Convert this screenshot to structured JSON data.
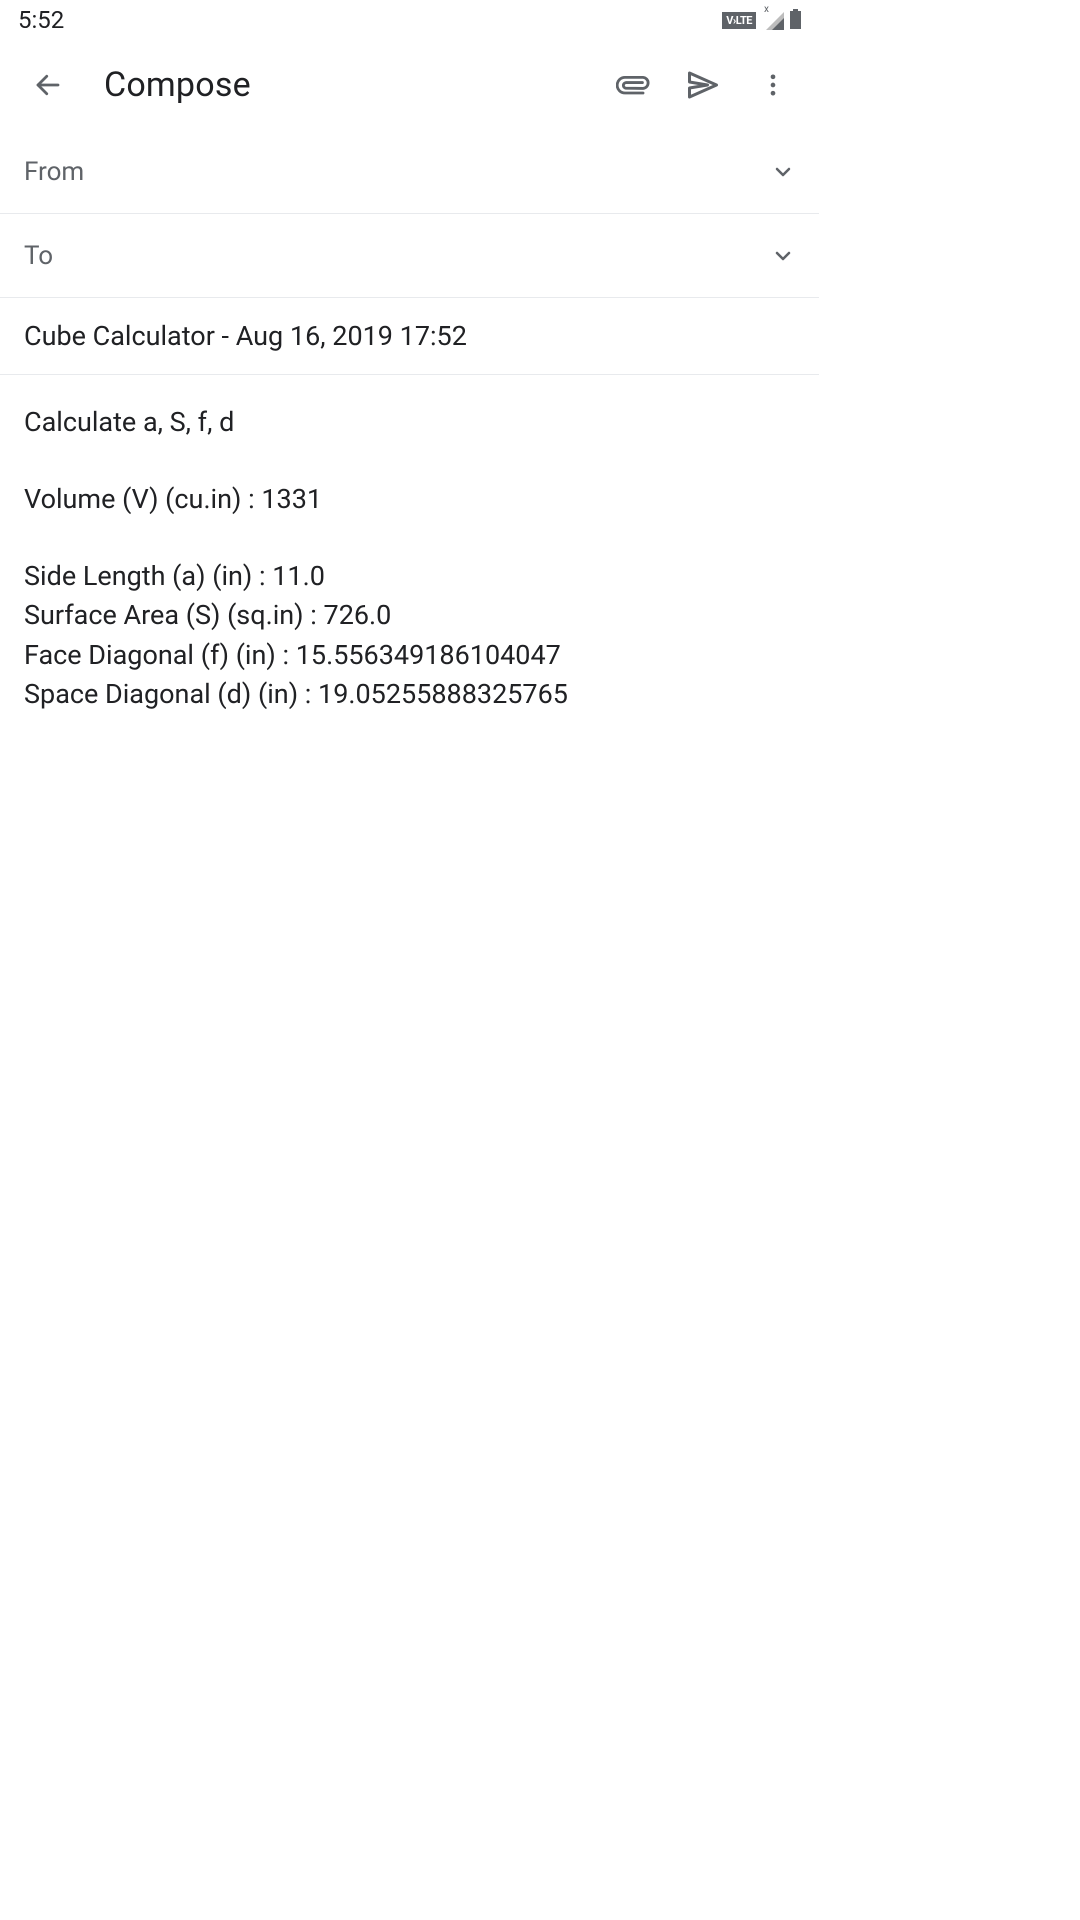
{
  "statusBar": {
    "time": "5:52",
    "volte": "V›LTE"
  },
  "toolbar": {
    "title": "Compose"
  },
  "fields": {
    "from_label": "From",
    "to_label": "To"
  },
  "subject": "Cube Calculator - Aug 16, 2019 17:52",
  "body": {
    "line1": "Calculate a, S, f, d",
    "line2": "Volume (V) (cu.in) : 1331",
    "line3": "Side Length (a) (in) : 11.0",
    "line4": "Surface Area (S) (sq.in) : 726.0",
    "line5": "Face Diagonal (f) (in) : 15.556349186104047",
    "line6": "Space Diagonal (d) (in) : 19.05255888325765"
  }
}
